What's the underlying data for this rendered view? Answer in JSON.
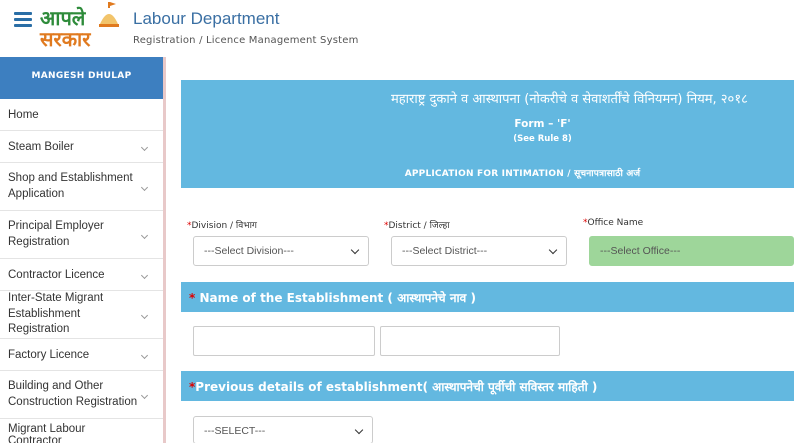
{
  "header": {
    "logo_line1": "आपले",
    "logo_line2": "सरकार",
    "title": "Labour Department",
    "subtitle": "Registration / Licence Management System"
  },
  "sidebar": {
    "user_name": "MANGESH DHULAP",
    "items": [
      {
        "label": "Home",
        "expandable": false
      },
      {
        "label": "Steam Boiler",
        "expandable": true
      },
      {
        "label": "Shop and Establishment Application",
        "expandable": true
      },
      {
        "label": "Principal Employer Registration",
        "expandable": true
      },
      {
        "label": "Contractor Licence",
        "expandable": true
      },
      {
        "label": "Inter-State Migrant Establishment Registration",
        "expandable": true
      },
      {
        "label": "Factory Licence",
        "expandable": true
      },
      {
        "label": "Building and Other Construction Registration",
        "expandable": true
      },
      {
        "label": "Migrant Labour Contractor",
        "expandable": false
      }
    ]
  },
  "form": {
    "title_marathi": "महाराष्ट्र दुकाने व आस्थापना (नोकरीचे व सेवाशर्तींचे विनियमन) नियम, २०१८",
    "form_name": "Form – 'F'",
    "rule_ref": "(See Rule 8)",
    "application_title": "APPLICATION FOR INTIMATION / सूचनापत्रासाठी अर्ज",
    "division": {
      "required": "*",
      "label": "Division / विभाग",
      "value": "---Select Division---"
    },
    "district": {
      "required": "*",
      "label": "District / जिल्हा",
      "value": "---Select District---"
    },
    "office": {
      "required": "*",
      "label": "Office Name",
      "value": "---Select Office---"
    },
    "establishment_name_section": {
      "required": "*",
      "label": " Name of the Establishment ( आस्थापनेचे नाव )"
    },
    "previous_details_section": {
      "required": "*",
      "label": "Previous details of establishment( आस्थापनेची पूर्वीची सविस्तर माहिती )"
    },
    "previous_select": {
      "value": "---SELECT---"
    }
  },
  "colors": {
    "accent_blue": "#63b8e0",
    "banner_blue": "#3d7fc0",
    "office_green": "#9ed69a",
    "required_red": "#d00000"
  }
}
